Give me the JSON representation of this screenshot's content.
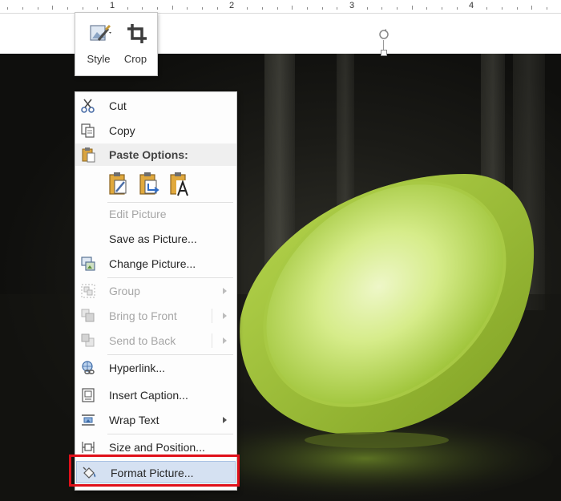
{
  "ruler": {
    "marks": [
      "1",
      "2",
      "3",
      "4"
    ]
  },
  "mini_toolbar": {
    "style_label": "Style",
    "crop_label": "Crop"
  },
  "context_menu": {
    "cut": "Cut",
    "copy": "Copy",
    "paste_options": "Paste Options:",
    "edit_picture": "Edit Picture",
    "save_as_picture": "Save as Picture...",
    "change_picture": "Change Picture...",
    "group": "Group",
    "bring_to_front": "Bring to Front",
    "send_to_back": "Send to Back",
    "hyperlink": "Hyperlink...",
    "insert_caption": "Insert Caption...",
    "wrap_text": "Wrap Text",
    "size_and_position": "Size and Position...",
    "format_picture": "Format Picture..."
  },
  "colors": {
    "highlight": "#d5e1f2",
    "callout_border": "#e0101a",
    "lamp_glow": "#c8e66a"
  }
}
